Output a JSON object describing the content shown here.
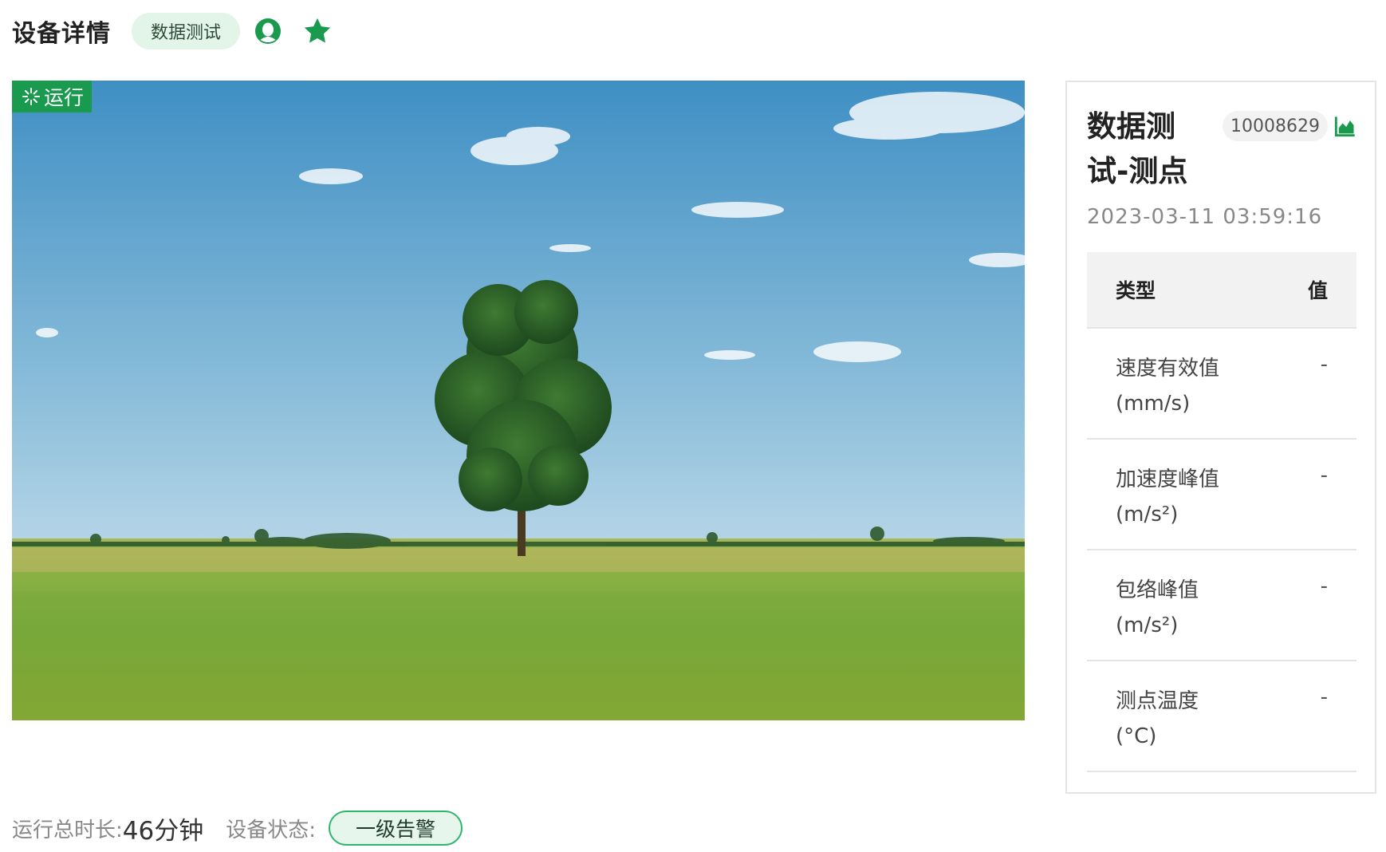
{
  "header": {
    "title": "设备详情",
    "device_name": "数据测试",
    "icons": [
      "user-icon",
      "star-icon"
    ],
    "accent_color": "#1a9a4f"
  },
  "image": {
    "status_badge": "运行",
    "status_icon": "running-spinner-icon"
  },
  "footer": {
    "runtime_label": "运行总时长:",
    "runtime_value": "46分钟",
    "status_label": "设备状态:",
    "status_value": "一级告警"
  },
  "panel": {
    "point_title_line1": "数据测",
    "point_title_line2": "试-测点",
    "point_code": "10008629",
    "chart_icon": "area-chart-icon",
    "timestamp": "2023-03-11 03:59:16",
    "table": {
      "headers": {
        "type": "类型",
        "value": "值"
      },
      "rows": [
        {
          "label_line1": "速度有效值",
          "label_line2": "(mm/s)",
          "value": "-"
        },
        {
          "label_line1": "加速度峰值",
          "label_line2": "(m/s²)",
          "value": "-"
        },
        {
          "label_line1": "包络峰值",
          "label_line2": "(m/s²)",
          "value": "-"
        },
        {
          "label_line1": "测点温度",
          "label_line2": "(°C)",
          "value": "-"
        }
      ]
    }
  }
}
